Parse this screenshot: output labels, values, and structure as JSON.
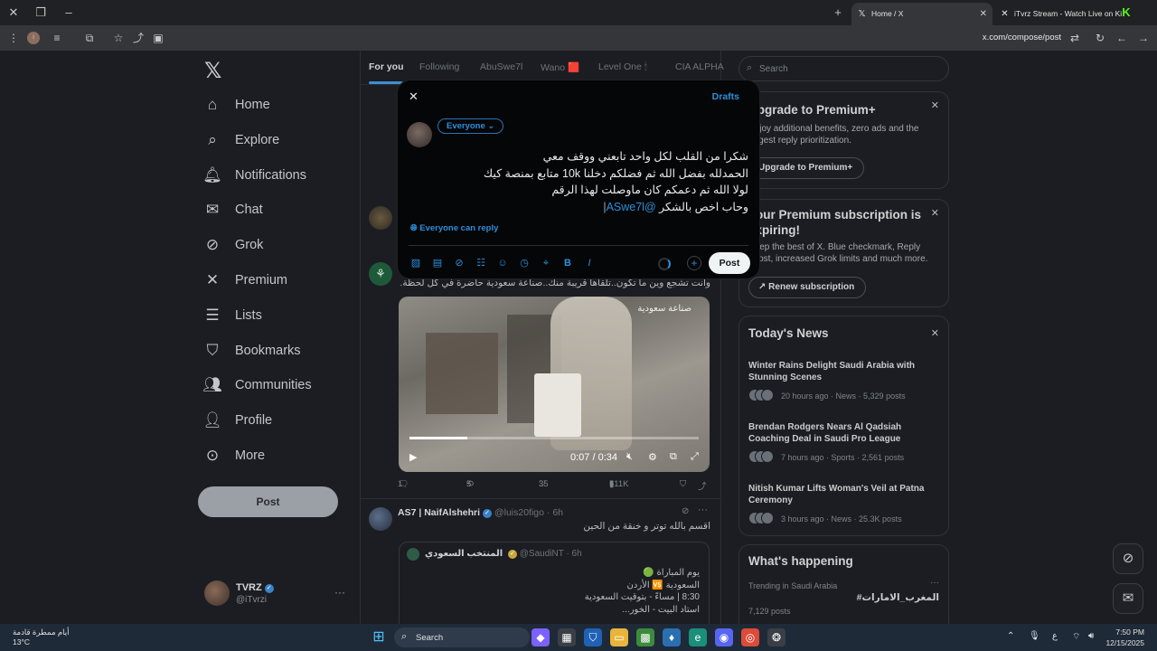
{
  "browser": {
    "tabs": [
      {
        "title": "Home / X",
        "active": true
      },
      {
        "title": "iTvrz Stream - Watch Live on Ki",
        "active": false
      }
    ],
    "url": "x.com/compose/post"
  },
  "sidebar": {
    "items": [
      {
        "label": "Home",
        "icon": "home-icon"
      },
      {
        "label": "Explore",
        "icon": "search-icon"
      },
      {
        "label": "Notifications",
        "icon": "bell-icon"
      },
      {
        "label": "Chat",
        "icon": "mail-icon"
      },
      {
        "label": "Grok",
        "icon": "grok-icon"
      },
      {
        "label": "Premium",
        "icon": "x-icon"
      },
      {
        "label": "Lists",
        "icon": "list-icon"
      },
      {
        "label": "Bookmarks",
        "icon": "bookmark-icon"
      },
      {
        "label": "Communities",
        "icon": "people-icon"
      },
      {
        "label": "Profile",
        "icon": "person-icon"
      },
      {
        "label": "More",
        "icon": "more-circle-icon"
      }
    ],
    "post_label": "Post",
    "account": {
      "name": "TVRZ",
      "handle": "@iTvrzi"
    }
  },
  "feed": {
    "tabs": [
      "For you",
      "Following",
      "AbuSwe7l",
      "Wano 🟥",
      "Level One 🕯",
      "CIA ALPHA"
    ],
    "tweet1": {
      "text": "وانت تشجع وين ما تكون..تلقاها قريبة منك..صناعة سعودية حاضرة في كل لحظة.",
      "brand": "صناعة سعودية",
      "video_time": "0:07 / 0:34",
      "video_progress": 0.2,
      "stats": {
        "replies": "1",
        "reposts": "5",
        "likes": "35",
        "views": "511K"
      }
    },
    "tweet2": {
      "name": "AS7 | NaifAlshehri",
      "handle": "@luis20figo",
      "time": "· 6h",
      "text": "اقسم بالله توتر و خنقة من الحين",
      "quote": {
        "name": "المنتخب السعودي",
        "handle": "@SaudiNT",
        "time": "· 6h",
        "lines": [
          "يوم المباراة 🟢",
          "السعودية 🆚 الأردن",
          "8:30 | مساءً - بتوقيت السعودية",
          "استاد البيت - الخور..."
        ]
      }
    }
  },
  "right": {
    "search_placeholder": "Search",
    "premium": {
      "title": "Upgrade to Premium+",
      "text": "Enjoy additional benefits, zero ads and the largest reply prioritization.",
      "button": "Upgrade to Premium+"
    },
    "expiring": {
      "title": "Your Premium subscription is expiring!",
      "text": "Keep the best of X. Blue checkmark, Reply boost, increased Grok limits and much more.",
      "button": "Renew subscription"
    },
    "news": {
      "title": "Today's News",
      "items": [
        {
          "headline": "Winter Rains Delight Saudi Arabia with Stunning Scenes",
          "meta": "20 hours ago · News · 5,329 posts"
        },
        {
          "headline": "Brendan Rodgers Nears Al Qadsiah Coaching Deal in Saudi Pro League",
          "meta": "7 hours ago · Sports · 2,561 posts"
        },
        {
          "headline": "Nitish Kumar Lifts Woman's Veil at Patna Ceremony",
          "meta": "3 hours ago · News · 25.3K posts"
        }
      ]
    },
    "happening": {
      "title": "What's happening",
      "context": "Trending in Saudi Arabia",
      "topic": "#المغرب_الامارات",
      "count": "7,129 posts"
    }
  },
  "compose": {
    "drafts": "Drafts",
    "audience": "Everyone",
    "lines": [
      "شكرا من القلب لكل واحد تابعني ووقف معي",
      "الحمدلله بفضل الله ثم فضلكم دخلنا 10k متابع بمنصة كيك",
      "لولا الله ثم دعمكم كان ماوصلت لهذا الرقم",
      "وحاب اخص بالشكر"
    ],
    "mention": "@ASwe7l",
    "reply_setting": "Everyone can reply",
    "post_label": "Post"
  },
  "taskbar": {
    "weather_text": "أيام ممطرة قادمة",
    "temp": "13°C",
    "search": "Search",
    "time": "7:50 PM",
    "date": "12/15/2025"
  }
}
